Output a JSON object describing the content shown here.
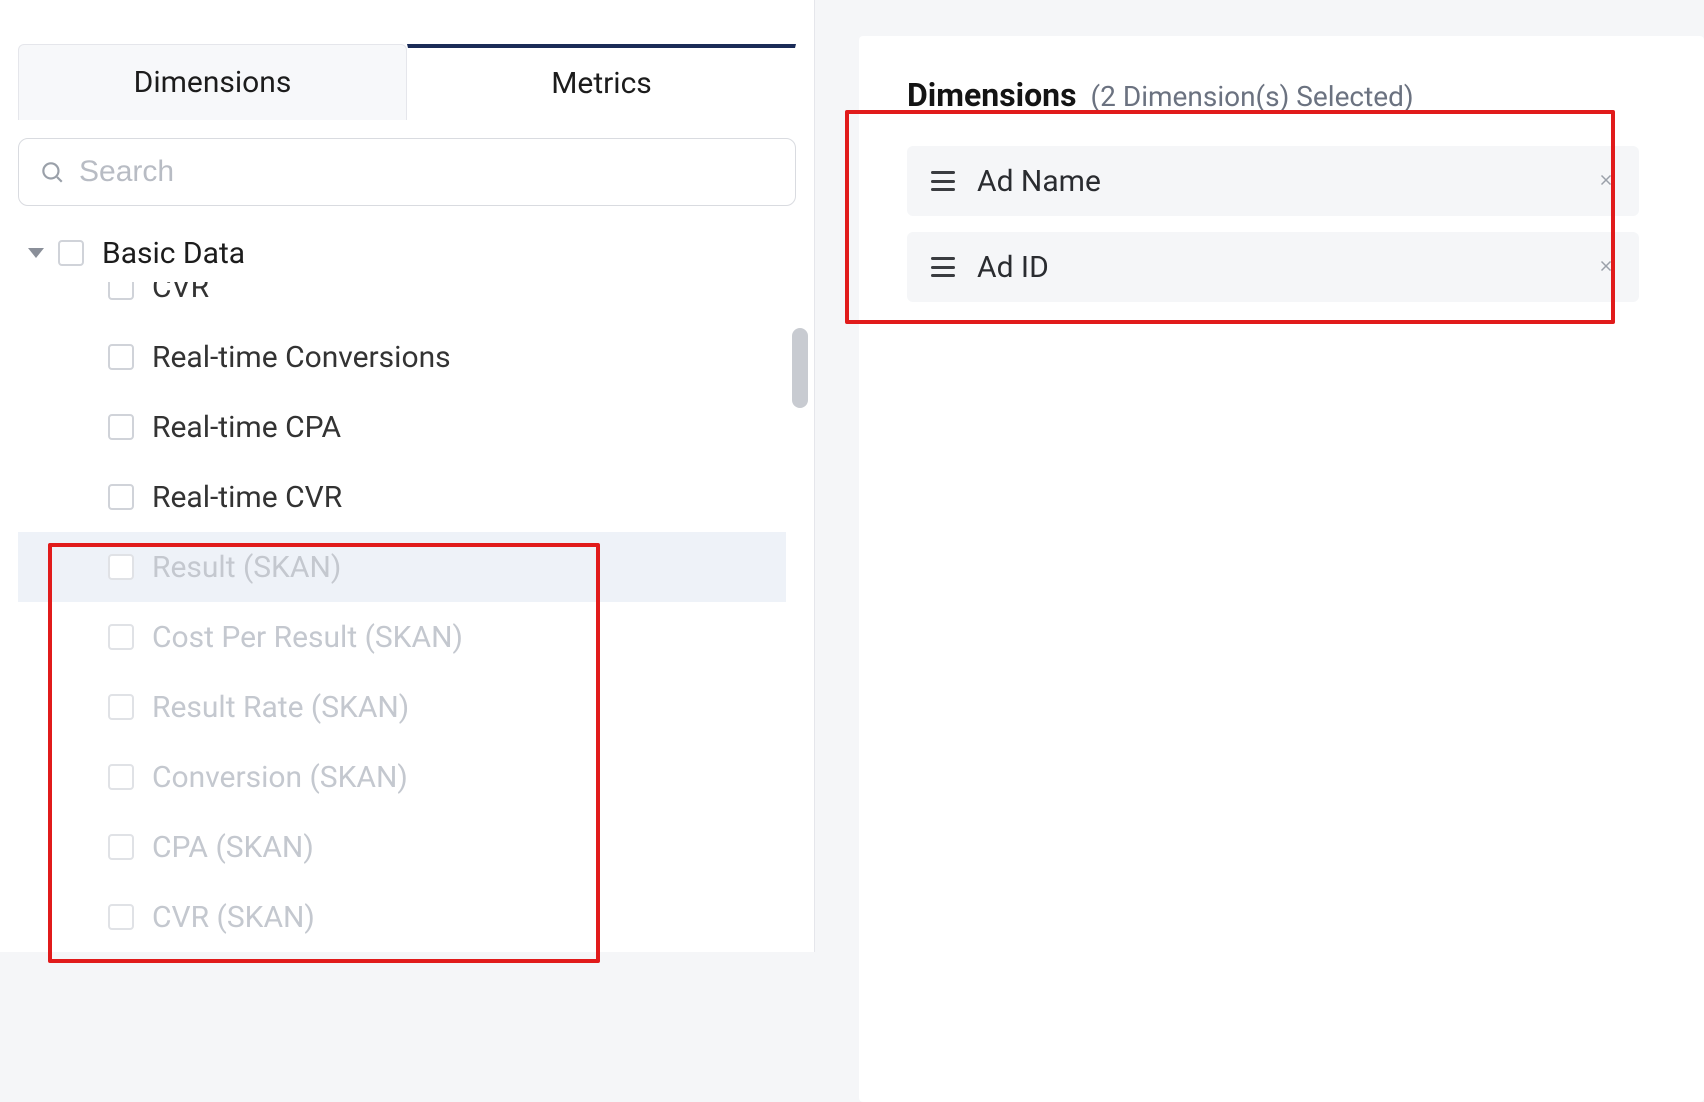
{
  "tabs": {
    "dimensions": "Dimensions",
    "metrics": "Metrics",
    "active": "metrics"
  },
  "search": {
    "placeholder": "Search"
  },
  "tree": {
    "group_label": "Basic Data",
    "items": [
      {
        "label": "CVR",
        "disabled": false,
        "highlight": false,
        "clipped": true
      },
      {
        "label": "Real-time Conversions",
        "disabled": false,
        "highlight": false
      },
      {
        "label": "Real-time CPA",
        "disabled": false,
        "highlight": false
      },
      {
        "label": "Real-time CVR",
        "disabled": false,
        "highlight": false
      },
      {
        "label": "Result (SKAN)",
        "disabled": true,
        "highlight": true
      },
      {
        "label": "Cost Per Result (SKAN)",
        "disabled": true,
        "highlight": false
      },
      {
        "label": "Result Rate (SKAN)",
        "disabled": true,
        "highlight": false
      },
      {
        "label": "Conversion (SKAN)",
        "disabled": true,
        "highlight": false
      },
      {
        "label": "CPA (SKAN)",
        "disabled": true,
        "highlight": false
      },
      {
        "label": "CVR (SKAN)",
        "disabled": true,
        "highlight": false
      }
    ]
  },
  "selected_panel": {
    "title": "Dimensions",
    "subtitle": "(2 Dimension(s) Selected)",
    "items": [
      {
        "label": "Ad Name"
      },
      {
        "label": "Ad ID"
      }
    ]
  }
}
